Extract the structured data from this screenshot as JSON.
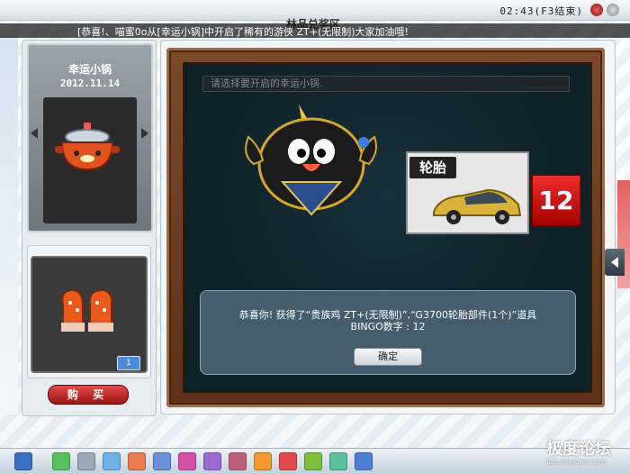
{
  "window_title": "林品兑奖区",
  "clock": "02:43(F3结束)",
  "ticker": "[恭喜!、喵蜜0o从[幸运小锅]中开启了稀有的游侠 ZT+(无限制)大家加油哦!",
  "left_panel": {
    "card_title": "幸运小锅",
    "card_date": "2012.11.14",
    "quantity_badge": "1",
    "buy_button": "购 买"
  },
  "main": {
    "open_input_placeholder": "请选择要开启的幸运小锅.",
    "reward_card_label": "轮胎",
    "bingo_number": "12",
    "result_message": "恭喜你! 获得了“贵族鸡 ZT+(无限制)”,“G3700轮胎部件(1个)”道具",
    "bingo_line": "BINGO数字 : 12",
    "confirm_button": "确定"
  },
  "watermark": {
    "title": "极度论坛",
    "url": "bbs.houdao.com"
  },
  "colors": {
    "accent_red": "#d21f1f",
    "board_bg": "#0e1f26",
    "panel_bg": "#4a6272",
    "wood": "#6b3d21"
  },
  "icons": {
    "taskbar": [
      "user-icon",
      "back-icon",
      "save-icon",
      "home-icon",
      "music-icon",
      "settings-icon",
      "gift-icon",
      "shop-icon",
      "mail-icon",
      "chat-icon",
      "game-icon",
      "friends-icon",
      "check-icon",
      "photo-icon"
    ]
  }
}
